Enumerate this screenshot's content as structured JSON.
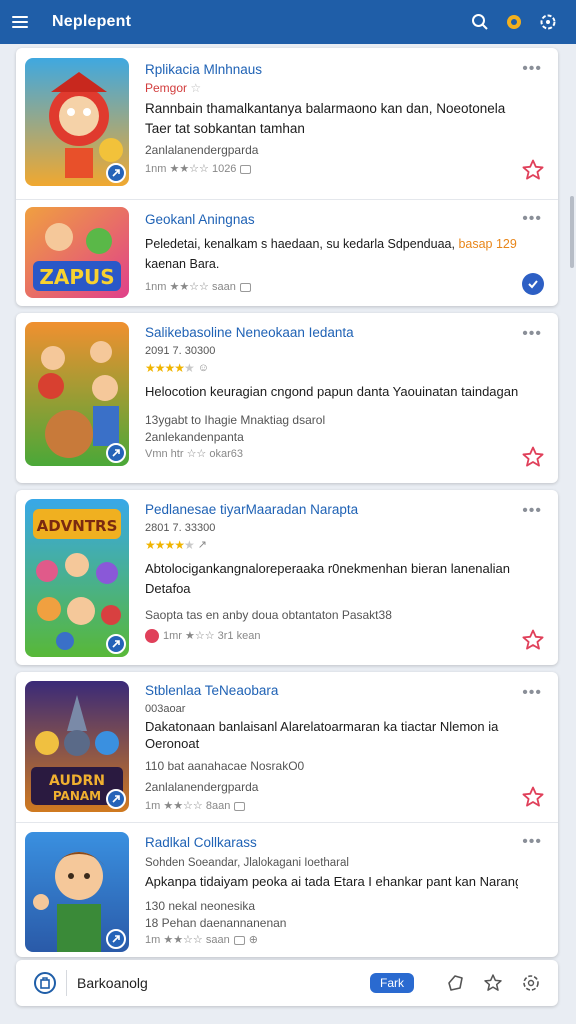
{
  "header": {
    "title": "Neplepent"
  },
  "cards": [
    {
      "items": [
        {
          "title": "Rplikacia Mlnhnaus",
          "subtitle": "Pemgor",
          "lines": [
            "Rannbain thamalkantanya balarmaono kan dan, Noeotonela",
            "Taer tat sobkantan tamhan"
          ],
          "small": "2anlalanendergparda",
          "rating": "1nm ★★☆☆ 1026",
          "action": "star"
        },
        {
          "title": "Geokanl Aningnas",
          "line_a": "Peledetai, kenalkam s haedaan, su kedarla Sdpenduaa,",
          "line_a_hl": "basap 129",
          "line_b": "kaenan Bara.",
          "rating": "1nm ★★☆☆ saan",
          "action": "check"
        }
      ]
    },
    {
      "items": [
        {
          "title": "Salikebasoline Neneokaan Iedanta",
          "top_small": "2091 7. 30300",
          "lines": [
            "Helocotion keuragian cngond papun danta Yaouinatan taindagan"
          ],
          "small_lines": [
            "13ygabt to Ihagie Mnaktiag dsarol",
            "2anlekandenpanta"
          ],
          "rating": "Vmn htr ☆☆ okar63",
          "action": "star"
        }
      ]
    },
    {
      "items": [
        {
          "title": "Pedlanesae tiyarMaaradan Narapta",
          "top_small": "2801 7. 33300",
          "lines": [
            "Abtolocigankangnaloreperaaka r0nekmenhan bieran lanenalian",
            "Detafoa"
          ],
          "small_lines": [
            "Saopta tas en anby doua obtantaton Pasakt38"
          ],
          "rating": "1mr ★☆☆ 3r1 kean",
          "action": "star"
        }
      ]
    },
    {
      "items": [
        {
          "title": "Stblenlaa TeNeaobara",
          "top_small": "003aoar",
          "lines": [
            "Dakatonaan banlaisanl Alarelatoarmaran ka tiactar Nlemon ia",
            "Oeronoat"
          ],
          "small_lines": [
            "110 bat aanahacae NosrakO0",
            "2anlalanendergparda"
          ],
          "rating": "1m ★★☆☆ 8aan",
          "action": "star"
        },
        {
          "title": "Radlkal Collkarass",
          "top_small": "Sohden Soeandar, Jlalokagani Ioetharal",
          "lines": [
            "Apkanpa tidaiyam peoka ai tada Etara I ehankar pant kan Narang"
          ],
          "small_lines": [
            "130 nekal neonesika",
            "18 Pehan daenannanenan"
          ],
          "rating": "1m ★★☆☆ saan",
          "action": "none"
        }
      ]
    }
  ],
  "bottom": {
    "label": "Barkoanolg",
    "pill": "Fark"
  }
}
